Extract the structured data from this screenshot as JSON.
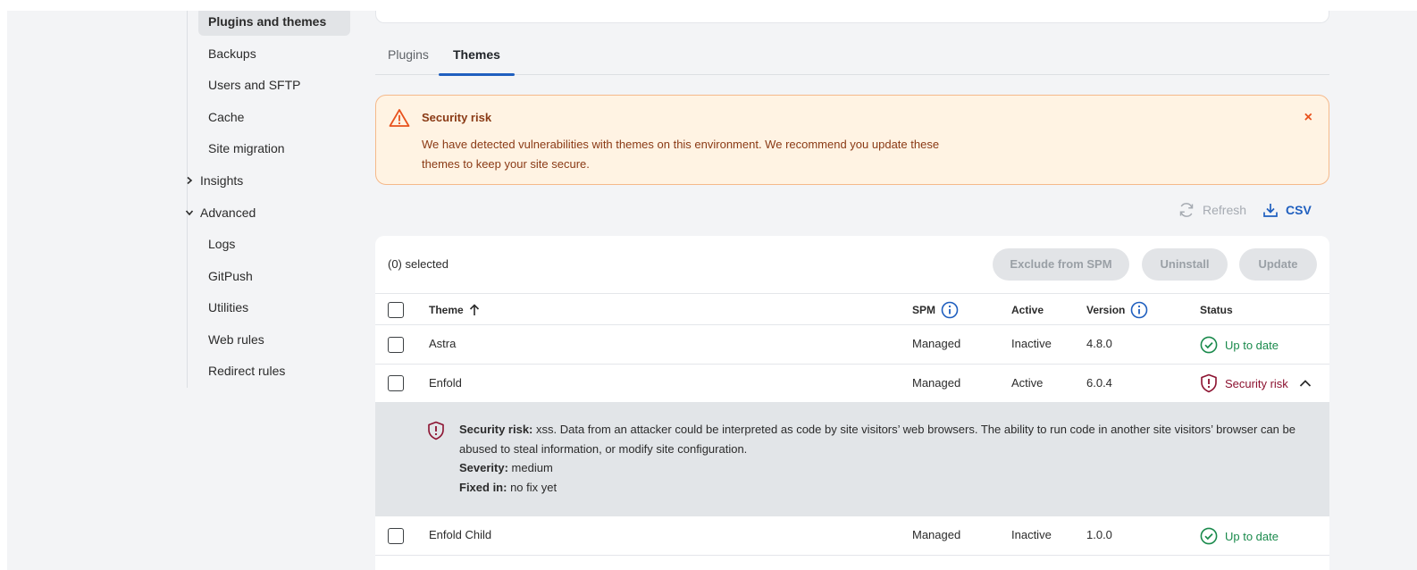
{
  "sidebar": {
    "items": [
      {
        "label": "Plugins and themes",
        "active": true
      },
      {
        "label": "Backups"
      },
      {
        "label": "Users and SFTP"
      },
      {
        "label": "Cache"
      },
      {
        "label": "Site migration"
      }
    ],
    "groups": [
      {
        "label": "Insights",
        "expanded": false
      },
      {
        "label": "Advanced",
        "expanded": true
      }
    ],
    "advanced_items": [
      {
        "label": "Logs"
      },
      {
        "label": "GitPush"
      },
      {
        "label": "Utilities"
      },
      {
        "label": "Web rules"
      },
      {
        "label": "Redirect rules"
      }
    ]
  },
  "tabs": [
    {
      "label": "Plugins",
      "active": false
    },
    {
      "label": "Themes",
      "active": true
    }
  ],
  "alert": {
    "title": "Security risk",
    "body": "We have detected vulnerabilities with themes on this environment. We recommend you update these themes to keep your site secure.",
    "close_glyph": "×",
    "icon": "warning-triangle-icon",
    "accent": "#e8511c"
  },
  "toolbar": {
    "refresh_label": "Refresh",
    "csv_label": "CSV"
  },
  "table": {
    "selected_label": "(0) selected",
    "bulk_actions": {
      "exclude": "Exclude from SPM",
      "uninstall": "Uninstall",
      "update": "Update"
    },
    "columns": {
      "theme": "Theme",
      "spm": "SPM",
      "active": "Active",
      "version": "Version",
      "status": "Status"
    },
    "rows": [
      {
        "theme": "Astra",
        "spm": "Managed",
        "active": "Inactive",
        "version": "4.8.0",
        "status": "Up to date",
        "status_type": "ok"
      },
      {
        "theme": "Enfold",
        "spm": "Managed",
        "active": "Active",
        "version": "6.0.4",
        "status": "Security risk",
        "status_type": "risk",
        "expanded": true
      },
      {
        "theme": "Enfold Child",
        "spm": "Managed",
        "active": "Inactive",
        "version": "1.0.0",
        "status": "Up to date",
        "status_type": "ok"
      }
    ],
    "detail": {
      "risk_label": "Security risk:",
      "risk_text": "xss. Data from an attacker could be interpreted as code by site visitors’ web browsers. The ability to run code in another site visitors’ browser can be abused to steal information, or modify site configuration.",
      "severity_label": "Severity:",
      "severity_value": "medium",
      "fixed_label": "Fixed in:",
      "fixed_value": "no fix yet"
    }
  },
  "colors": {
    "ok": "#1a8a4c",
    "risk": "#8c1230",
    "primary": "#1f5fbf"
  }
}
